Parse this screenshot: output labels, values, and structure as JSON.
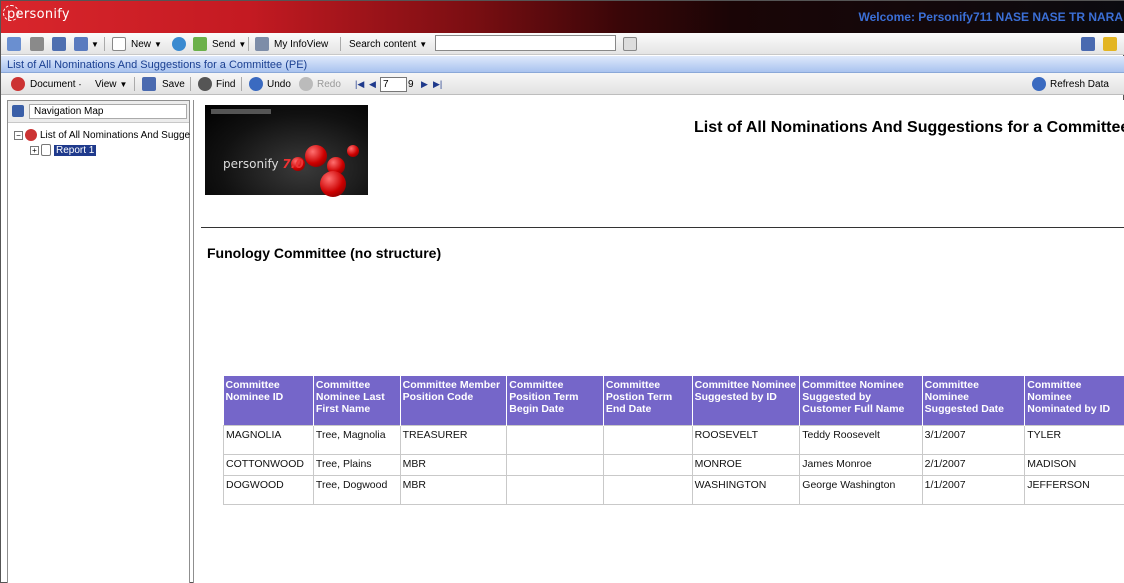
{
  "banner": {
    "logo": "personify",
    "welcome": "Welcome: Personify711 NASE NASE TR NARA"
  },
  "toolbar": {
    "new_label": "New",
    "send_label": "Send",
    "my_infoview_label": "My InfoView",
    "search_label": "Search content",
    "search_value": ""
  },
  "document_bar": {
    "title": "List of All Nominations And Suggestions for a Committee (PE)"
  },
  "doc_toolbar": {
    "document_label": "Document",
    "view_label": "View",
    "save_label": "Save",
    "find_label": "Find",
    "undo_label": "Undo",
    "redo_label": "Redo",
    "page_value": "7",
    "page_total": "9",
    "refresh_label": "Refresh Data"
  },
  "left_panel": {
    "nav_select": "Navigation Map",
    "tree_root": "List of All Nominations And Sugge",
    "tree_child": "Report 1"
  },
  "report": {
    "image_brand": "personify",
    "image_version": "7.0",
    "title": "List of All Nominations And Suggestions for a Committee",
    "section": "Funology Committee (no structure)",
    "columns": [
      "Committee Nominee ID",
      "Committee Nominee Last First Name",
      "Committee Member Position Code",
      "Committee Position Term Begin Date",
      "Committee Postion Term End Date",
      "Committee Nominee Suggested by ID",
      "Committee Nominee Suggested by Customer Full Name",
      "Committee Nominee Suggested Date",
      "Committee Nominee Nominated by ID"
    ],
    "rows": [
      [
        "MAGNOLIA",
        "Tree, Magnolia",
        "TREASURER",
        "",
        "",
        "ROOSEVELT",
        "Teddy Roosevelt",
        "3/1/2007",
        "TYLER"
      ],
      [
        "COTTONWOOD",
        "Tree, Plains",
        "MBR",
        "",
        "",
        "MONROE",
        "James Monroe",
        "2/1/2007",
        "MADISON"
      ],
      [
        "DOGWOOD",
        "Tree, Dogwood",
        "MBR",
        "",
        "",
        "WASHINGTON",
        "George Washington",
        "1/1/2007",
        "JEFFERSON"
      ]
    ]
  }
}
